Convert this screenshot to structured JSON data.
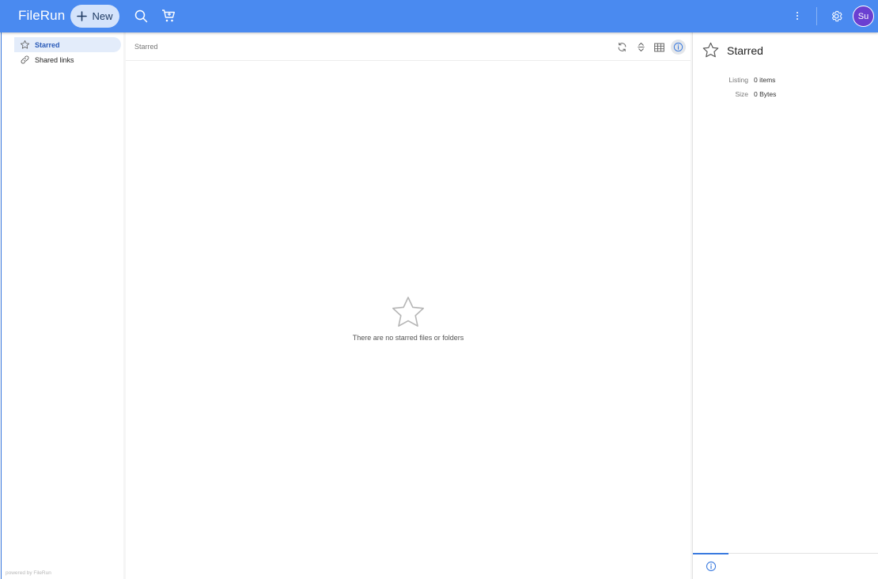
{
  "topbar": {
    "brand": "FileRun",
    "new_label": "New",
    "avatar_initials": "Su",
    "accent_color": "#4a8af0",
    "icons": [
      "search-icon",
      "cart-icon",
      "more-vertical-icon",
      "gear-icon"
    ]
  },
  "sidebar": {
    "items": [
      {
        "label": "Starred",
        "icon": "star-icon",
        "active": true
      },
      {
        "label": "Shared links",
        "icon": "link-icon",
        "active": false
      }
    ],
    "footer": "powered by FileRun"
  },
  "main": {
    "breadcrumb": "Starred",
    "toolbar": [
      "refresh-icon",
      "sort-icon",
      "grid-view-icon",
      "info-icon"
    ],
    "empty_message": "There are no starred files or folders"
  },
  "details": {
    "title": "Starred",
    "rows": [
      {
        "key": "Listing",
        "value": "0 items"
      },
      {
        "key": "Size",
        "value": "0 Bytes"
      }
    ],
    "tabs": [
      "info-icon"
    ]
  }
}
